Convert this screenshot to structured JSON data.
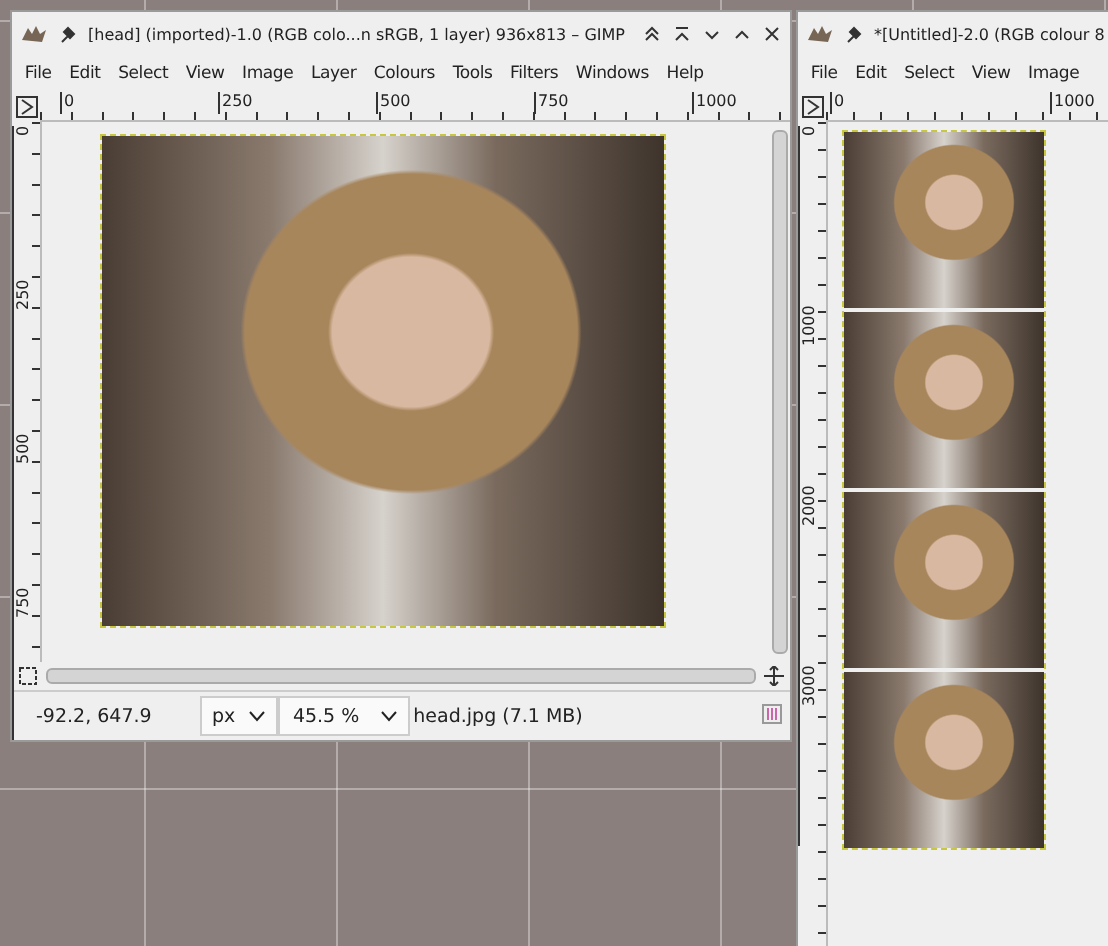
{
  "windows": [
    {
      "title": "[head] (imported)-1.0 (RGB colo...n sRGB, 1 layer) 936x813 – GIMP",
      "kind": "main",
      "menu": [
        "File",
        "Edit",
        "Select",
        "View",
        "Image",
        "Layer",
        "Colours",
        "Tools",
        "Filters",
        "Windows",
        "Help"
      ],
      "hruler": [
        "0",
        "250",
        "500",
        "750",
        "1000"
      ],
      "vruler": [
        "0",
        "250",
        "500",
        "750"
      ],
      "status": {
        "pointer": "-92.2, 647.9",
        "unit": "px",
        "zoom": "45.5 %",
        "file": "head.jpg (7.1 MB)"
      }
    },
    {
      "title": "*[Untitled]-2.0 (RGB colour 8",
      "kind": "strip",
      "menu": [
        "File",
        "Edit",
        "Select",
        "View",
        "Image"
      ],
      "hruler": [
        "0",
        "1000"
      ],
      "vruler": [
        "0",
        "1000",
        "2000",
        "3000"
      ]
    }
  ]
}
